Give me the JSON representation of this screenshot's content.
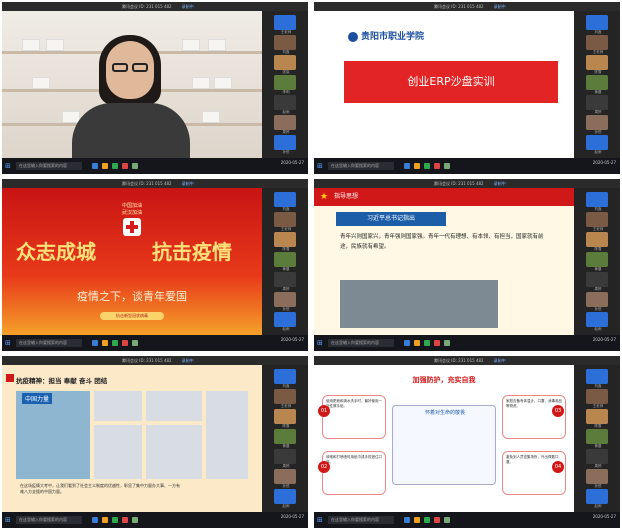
{
  "panels": [
    {
      "topbar": "腾讯会议 ID: 231 015 482",
      "rec": "录制中",
      "search": "在这里输入你要搜索的内容",
      "clock": "2020-05-27",
      "tiles": [
        "王老师",
        "刘鑫",
        "张晓",
        "李明",
        "赵雨",
        "周婷",
        "孙悦"
      ]
    },
    {
      "topbar": "腾讯会议 ID: 231 015 482",
      "rec": "录制中",
      "search": "在这里输入你要搜索的内容",
      "clock": "2020-05-27",
      "logo": "贵阳市职业学院",
      "slide_title": "创业ERP沙盘实训",
      "tiles": [
        "刘鑫",
        "王老师",
        "陈雪",
        "黄晨",
        "周婷",
        "孙悦",
        "赵雨"
      ]
    },
    {
      "topbar": "腾讯会议 ID: 231 015 482",
      "rec": "录制中",
      "search": "在这里输入你要搜索的内容",
      "clock": "2020-05-27",
      "small1": "中国加油",
      "small2": "武汉加油",
      "left_big": "众志成城",
      "right_big": "抗击疫情",
      "subtitle": "疫情之下，谈青年爱国",
      "pill": "抗击新型冠状病毒",
      "tiles": [
        "刘鑫",
        "王老师",
        "陈雪",
        "黄晨",
        "周婷",
        "孙悦",
        "赵雨"
      ]
    },
    {
      "topbar": "腾讯会议 ID: 231 015 482",
      "rec": "录制中",
      "search": "在这里输入你要搜索的内容",
      "clock": "2020-05-27",
      "header": "指导思想",
      "title": "习近平总书记指出",
      "quote": "青年兴则国家兴，青年强则国家强。青年一代有理想、有本领、有担当，国家就有前途，民族就有希望。",
      "tiles": [
        "刘鑫",
        "王老师",
        "陈雪",
        "黄晨",
        "周婷",
        "孙悦",
        "赵雨"
      ]
    },
    {
      "topbar": "腾讯会议 ID: 231 015 482",
      "rec": "录制中",
      "search": "在这里输入你要搜索的内容",
      "clock": "2020-05-27",
      "title": "抗疫精神：担当  奉献  奋斗  团结",
      "label": "中国力量",
      "text": "在这场疫情大考中，让我们看到了社会主义制度的优越性，彰显了集中力量办大事、一方有难八方支援的中国力量。",
      "tiles": [
        "刘鑫",
        "王老师",
        "陈雪",
        "黄晨",
        "周婷",
        "孙悦",
        "赵雨"
      ]
    },
    {
      "topbar": "腾讯会议 ID: 231 015 482",
      "rec": "录制中",
      "search": "在这里输入你要搜索的内容",
      "clock": "2020-05-27",
      "title": "加强防护，充实自我",
      "center": "怀着对生命的敬畏",
      "b1": "使用肥皂和清水洗手时，最好使用一次性擦手纸。",
      "b2": "咳嗽和打喷嚏时用纸巾或手肘遮住口鼻。",
      "b3": "家庭应备有体温计、口罩、消毒用品等物资。",
      "b4": "避免到人员密集场所，外出佩戴口罩。",
      "n1": "01",
      "n2": "02",
      "n3": "03",
      "n4": "04",
      "tiles": [
        "刘鑫",
        "王老师",
        "陈雪",
        "黄晨",
        "周婷",
        "孙悦",
        "赵雨"
      ]
    }
  ]
}
